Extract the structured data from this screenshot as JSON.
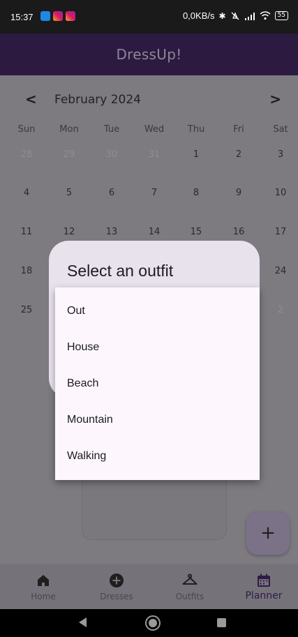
{
  "status_bar": {
    "time": "15:37",
    "network_speed": "0,0KB/s",
    "battery": "55",
    "icons": [
      "phone-app-icon",
      "instagram-icon",
      "instagram-icon",
      "bluetooth-icon",
      "silent-icon",
      "signal-icon",
      "wifi-icon",
      "battery-icon"
    ]
  },
  "app_bar": {
    "title": "DressUp!"
  },
  "calendar": {
    "month_label": "February 2024",
    "prev_glyph": "<",
    "next_glyph": ">",
    "weekdays": [
      "Sun",
      "Mon",
      "Tue",
      "Wed",
      "Thu",
      "Fri",
      "Sat"
    ],
    "weeks": [
      [
        "28",
        "29",
        "30",
        "31",
        "1",
        "2",
        "3"
      ],
      [
        "4",
        "5",
        "6",
        "7",
        "8",
        "9",
        "10"
      ],
      [
        "11",
        "12",
        "13",
        "14",
        "15",
        "16",
        "17"
      ],
      [
        "18",
        "",
        "",
        "",
        "",
        "",
        "24"
      ],
      [
        "25",
        "",
        "",
        "",
        "",
        "",
        "2"
      ]
    ]
  },
  "dialog": {
    "title": "Select an outfit",
    "options": [
      "Out",
      "House",
      "Beach",
      "Mountain",
      "Walking"
    ]
  },
  "fab": {
    "label": "+"
  },
  "bottom_nav": {
    "items": [
      {
        "label": "Home",
        "icon": "home-icon"
      },
      {
        "label": "Dresses",
        "icon": "add-circle-icon"
      },
      {
        "label": "Outfits",
        "icon": "hanger-icon"
      },
      {
        "label": "Planner",
        "icon": "calendar-icon"
      }
    ],
    "active": "Planner"
  },
  "colors": {
    "app_bar": "#2c1a40",
    "scrim": "#7d7a80",
    "dialog": "#e8e2ec",
    "menu": "#fdf7fd",
    "active_nav": "#2e1c46"
  }
}
